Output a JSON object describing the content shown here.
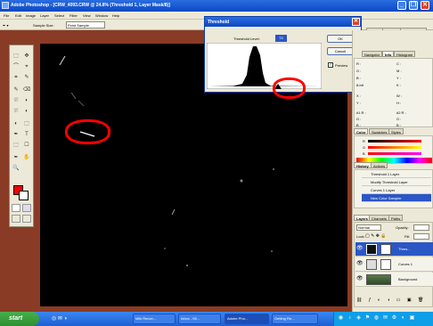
{
  "window": {
    "title": "Adobe Photoshop - [CRW_4093.CRW @ 24.8% (Threshold 1, Layer Mask/8)]",
    "buttons": {
      "minimize": "_",
      "restore": "❐",
      "close": "✕"
    }
  },
  "menu": [
    "File",
    "Edit",
    "Image",
    "Layer",
    "Select",
    "Filter",
    "View",
    "Window",
    "Help"
  ],
  "options_bar": {
    "sample_size_label": "Sample Size:",
    "sample_size_value": "Point Sample"
  },
  "palette_well_tabs": [
    "Brushes",
    "Tool Presets",
    "Layer Comps"
  ],
  "toolbox": {
    "tools": [
      "⬚",
      "✥",
      "⌒",
      "⌖",
      "⌗",
      "✎",
      "✎",
      "⌫",
      "⛆",
      "◐",
      "✒",
      "T",
      "⬚",
      "☐",
      "✋",
      "🔍"
    ],
    "foreground_color": "#ff0000",
    "background_color": "#ffffff"
  },
  "threshold_dialog": {
    "title": "Threshold",
    "level_label": "Threshold Level:",
    "level_value": "74",
    "ok_label": "OK",
    "cancel_label": "Cancel",
    "preview_label": "Preview",
    "preview_checked": true
  },
  "info_panel": {
    "tabs": [
      "Navigator",
      "Info",
      "Histogram"
    ],
    "rows": [
      {
        "c1": "R :",
        "v1": "",
        "c2": "C :",
        "v2": ""
      },
      {
        "c1": "G :",
        "v1": "",
        "c2": "M :",
        "v2": ""
      },
      {
        "c1": "B :",
        "v1": "",
        "c2": "Y :",
        "v2": ""
      },
      {
        "c1": "8-bit",
        "v1": "",
        "c2": "K :",
        "v2": ""
      },
      {
        "c1": "X :",
        "v1": "",
        "c2": "W :",
        "v2": ""
      },
      {
        "c1": "Y :",
        "v1": "",
        "c2": "H :",
        "v2": ""
      },
      {
        "c1": "#1 R :",
        "v1": "",
        "c2": "#2 R :",
        "v2": ""
      },
      {
        "c1": "G :",
        "v1": "",
        "c2": "G :",
        "v2": ""
      },
      {
        "c1": "B :",
        "v1": "",
        "c2": "B :",
        "v2": ""
      }
    ]
  },
  "color_panel": {
    "tabs": [
      "Color",
      "Swatches",
      "Styles"
    ],
    "channels": [
      "R",
      "G",
      "B"
    ]
  },
  "history_panel": {
    "tabs": [
      "History",
      "Actions"
    ],
    "items": [
      "Threshold 1 Layer",
      "Modify Threshold Layer",
      "Curves 1 Layer",
      "New Color Sampler"
    ],
    "selected_index": 3
  },
  "layers_panel": {
    "tabs": [
      "Layers",
      "Channels",
      "Paths"
    ],
    "blend_mode": "Normal",
    "opacity_label": "Opacity:",
    "lock_label": "Lock:",
    "fill_label": "Fill:",
    "layers": [
      "Thres...",
      "Curves 1",
      "Background"
    ],
    "selected_index": 0
  },
  "taskbar": {
    "start_label": "start",
    "tasks": [
      "Milk Recon...",
      "Inbox - Mi...",
      "Adobe Pho...",
      "Getting Re..."
    ],
    "active_index": 2
  }
}
